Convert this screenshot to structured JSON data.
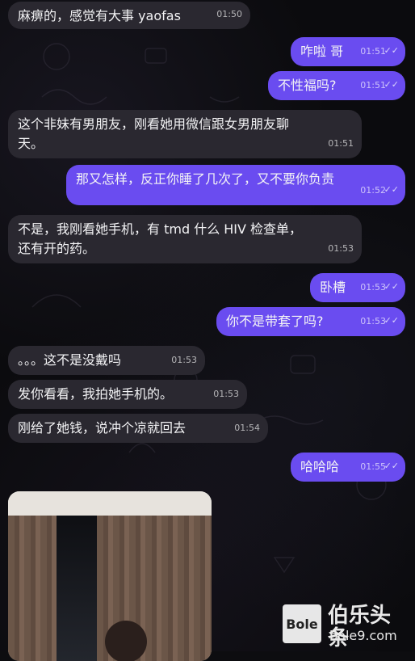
{
  "messages": [
    {
      "text": "麻痹的，感觉有大事 yaofas",
      "time": "01:50"
    },
    {
      "text": "咋啦 哥",
      "time": "01:51"
    },
    {
      "text": "不性福吗?",
      "time": "01:51"
    },
    {
      "text": "这个非妹有男朋友，刚看她用微信跟女男朋友聊\n天。",
      "time": "01:51"
    },
    {
      "text": "那又怎样，反正你睡了几次了，又不要你负责",
      "time": "01:52"
    },
    {
      "text": "不是，我刚看她手机，有 tmd 什么 HIV 检查单，\n还有开的药。",
      "time": "01:53"
    },
    {
      "text": "卧槽",
      "time": "01:53"
    },
    {
      "text": "你不是带套了吗?",
      "time": "01:53"
    },
    {
      "text": "。。。这不是没戴吗",
      "time": "01:53"
    },
    {
      "text": "发你看看，我拍她手机的。",
      "time": "01:53"
    },
    {
      "text": "刚给了她钱，说冲个凉就回去",
      "time": "01:54"
    },
    {
      "text": "哈哈哈",
      "time": "01:55"
    }
  ],
  "watermark": {
    "logo": "Bole",
    "title": "伯乐头条",
    "subtitle": "bole9.com"
  },
  "status_icon": "double-check-icon",
  "colors": {
    "incoming_bubble": "#2a2830",
    "outgoing_bubble": "#6a4cf0",
    "background": "#0b0b0e"
  }
}
